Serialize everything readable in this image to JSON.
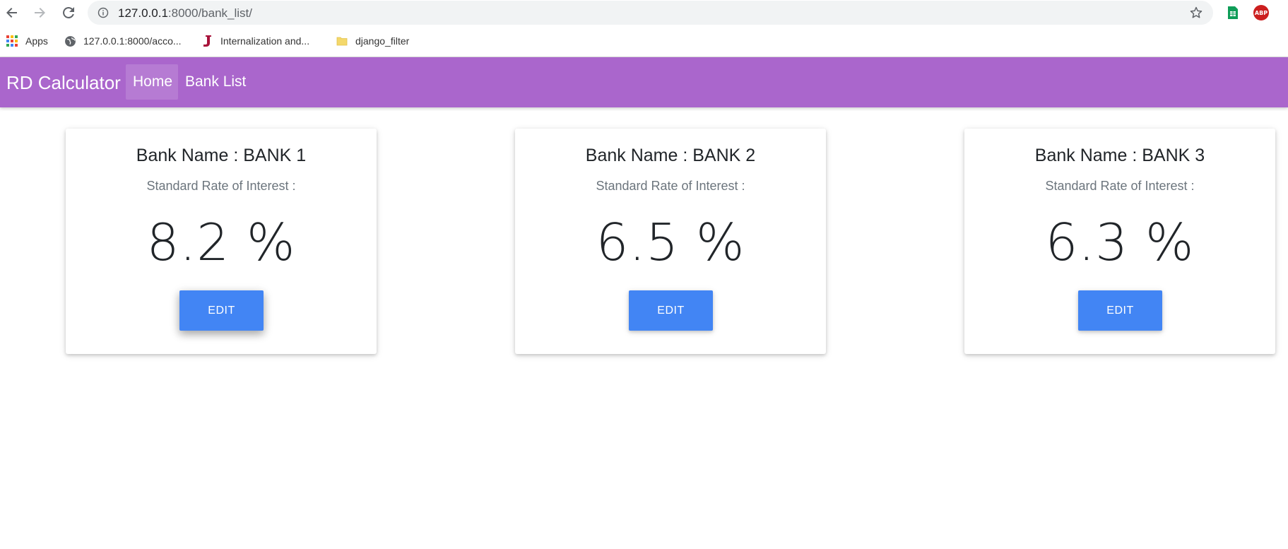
{
  "browser": {
    "url_host": "127.0.0.1",
    "url_rest": ":8000/bank_list/",
    "bookmarks": [
      {
        "label": "Apps",
        "icon": "apps-grid-icon"
      },
      {
        "label": "127.0.0.1:8000/acco...",
        "icon": "globe-icon"
      },
      {
        "label": "Internalization and...",
        "icon": "j-logo-icon"
      },
      {
        "label": "django_filter",
        "icon": "folder-icon"
      }
    ],
    "abp_label": "ABP"
  },
  "navbar": {
    "brand": "RD Calculator",
    "links": [
      {
        "label": "Home",
        "active": true
      },
      {
        "label": "Bank List",
        "active": false
      }
    ],
    "color": "#aa66cc"
  },
  "banks": [
    {
      "title": "Bank Name : BANK 1",
      "subtitle": "Standard Rate of Interest :",
      "rate": "8.2 %",
      "button": "EDIT"
    },
    {
      "title": "Bank Name : BANK 2",
      "subtitle": "Standard Rate of Interest :",
      "rate": "6.5 %",
      "button": "EDIT"
    },
    {
      "title": "Bank Name : BANK 3",
      "subtitle": "Standard Rate of Interest :",
      "rate": "6.3 %",
      "button": "EDIT"
    }
  ],
  "colors": {
    "button": "#4285f4",
    "text": "#212529",
    "muted": "#6c757d"
  }
}
